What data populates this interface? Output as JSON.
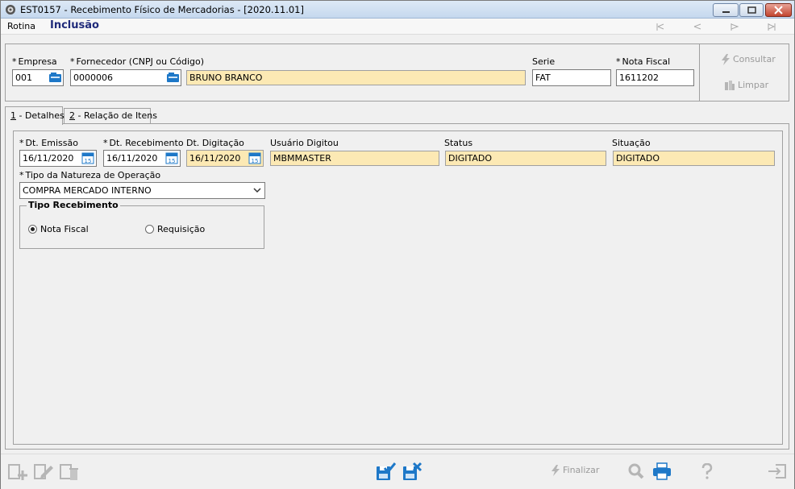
{
  "window": {
    "title": "EST0157 - Recebimento Físico de Mercadorias - [2020.11.01]"
  },
  "menu": {
    "rotina": "Rotina",
    "mode": "Inclusão"
  },
  "header": {
    "empresa_label": "Empresa",
    "empresa_value": "001",
    "fornecedor_label": "Fornecedor (CNPJ ou Código)",
    "fornecedor_code": "0000006",
    "fornecedor_name": "BRUNO BRANCO",
    "serie_label": "Serie",
    "serie_value": "FAT",
    "nota_label": "Nota Fiscal",
    "nota_value": "1611202",
    "required_mark": "*",
    "consultar_label": "Consultar",
    "limpar_label": "Limpar"
  },
  "tabs": [
    {
      "num": "1",
      "label": " - Detalhes"
    },
    {
      "num": "2",
      "label": " - Relação de Itens"
    }
  ],
  "details": {
    "dt_emissao_label": "Dt. Emissão",
    "dt_emissao_value": "16/11/2020",
    "dt_recebimento_label": "Dt. Recebimento",
    "dt_recebimento_value": "16/11/2020",
    "dt_digitacao_label": "Dt. Digitação",
    "dt_digitacao_value": "16/11/2020",
    "usuario_label": "Usuário Digitou",
    "usuario_value": "MBMMASTER",
    "status_label": "Status",
    "status_value": "DIGITADO",
    "situacao_label": "Situação",
    "situacao_value": "DIGITADO",
    "natureza_label": "Tipo da Natureza de Operação",
    "natureza_value": "COMPRA MERCADO INTERNO",
    "tipo_recebimento_legend": "Tipo Recebimento",
    "radio_nota_fiscal": "Nota Fiscal",
    "radio_requisicao": "Requisição",
    "calendar_day": "15"
  },
  "bottom": {
    "finalizar_label": "Finalizar"
  },
  "colors": {
    "readonly_bg": "#fce9b4",
    "mode_text": "#1f2a7a",
    "accent_blue": "#1e78c8"
  }
}
